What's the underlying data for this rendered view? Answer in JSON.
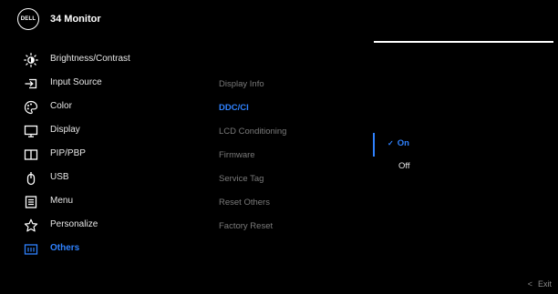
{
  "header": {
    "logo_text": "DELL",
    "title": "34 Monitor"
  },
  "menu": {
    "items": [
      {
        "label": "Brightness/Contrast",
        "icon": "brightness-icon"
      },
      {
        "label": "Input Source",
        "icon": "input-source-icon"
      },
      {
        "label": "Color",
        "icon": "color-icon"
      },
      {
        "label": "Display",
        "icon": "display-icon"
      },
      {
        "label": "PIP/PBP",
        "icon": "pip-pbp-icon"
      },
      {
        "label": "USB",
        "icon": "usb-icon"
      },
      {
        "label": "Menu",
        "icon": "menu-icon"
      },
      {
        "label": "Personalize",
        "icon": "star-icon"
      },
      {
        "label": "Others",
        "icon": "others-icon"
      }
    ],
    "active_index": 8
  },
  "submenu": {
    "items": [
      "Display Info",
      "DDC/CI",
      "LCD Conditioning",
      "Firmware",
      "Service Tag",
      "Reset Others",
      "Factory Reset"
    ],
    "active_index": 1
  },
  "options": {
    "checkmark": "✓",
    "on_label": "On",
    "off_label": "Off",
    "selected": "On"
  },
  "footer": {
    "exit_arrow": "<",
    "exit_label": "Exit"
  },
  "colors": {
    "accent": "#2f82ff",
    "background": "#000000",
    "text": "#e8e8e8",
    "muted": "#7a7a7a"
  }
}
